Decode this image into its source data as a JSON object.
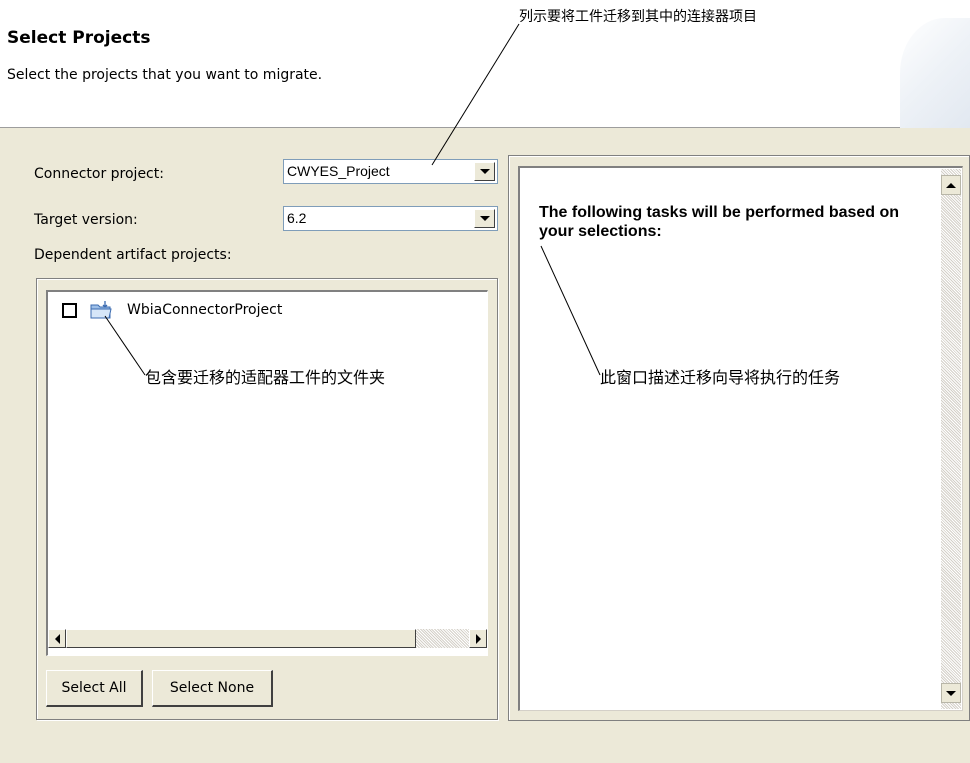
{
  "header": {
    "title": "Select Projects",
    "description": "Select the projects that you want to migrate."
  },
  "form": {
    "connector_project_label": "Connector project:",
    "connector_project_value": "CWYES_Project",
    "target_version_label": "Target version:",
    "target_version_value": "6.2",
    "dependent_label": "Dependent artifact projects:"
  },
  "tree": {
    "items": [
      {
        "label": "WbiaConnectorProject",
        "checked": false,
        "icon": "folder-icon"
      }
    ]
  },
  "buttons": {
    "select_all": "Select All",
    "select_none": "Select None"
  },
  "task_panel": {
    "text": "The following tasks will be performed based on your selections:"
  },
  "annotations": {
    "connector_callout": "列示要将工件迁移到其中的连接器项目",
    "folder_callout": "包含要迁移的适配器工件的文件夹",
    "window_callout": "此窗口描述迁移向导将执行的任务"
  },
  "colors": {
    "dialog_background": "#ece9d8",
    "field_border": "#7f9db9",
    "folder_icon": "#7ea6d8"
  }
}
